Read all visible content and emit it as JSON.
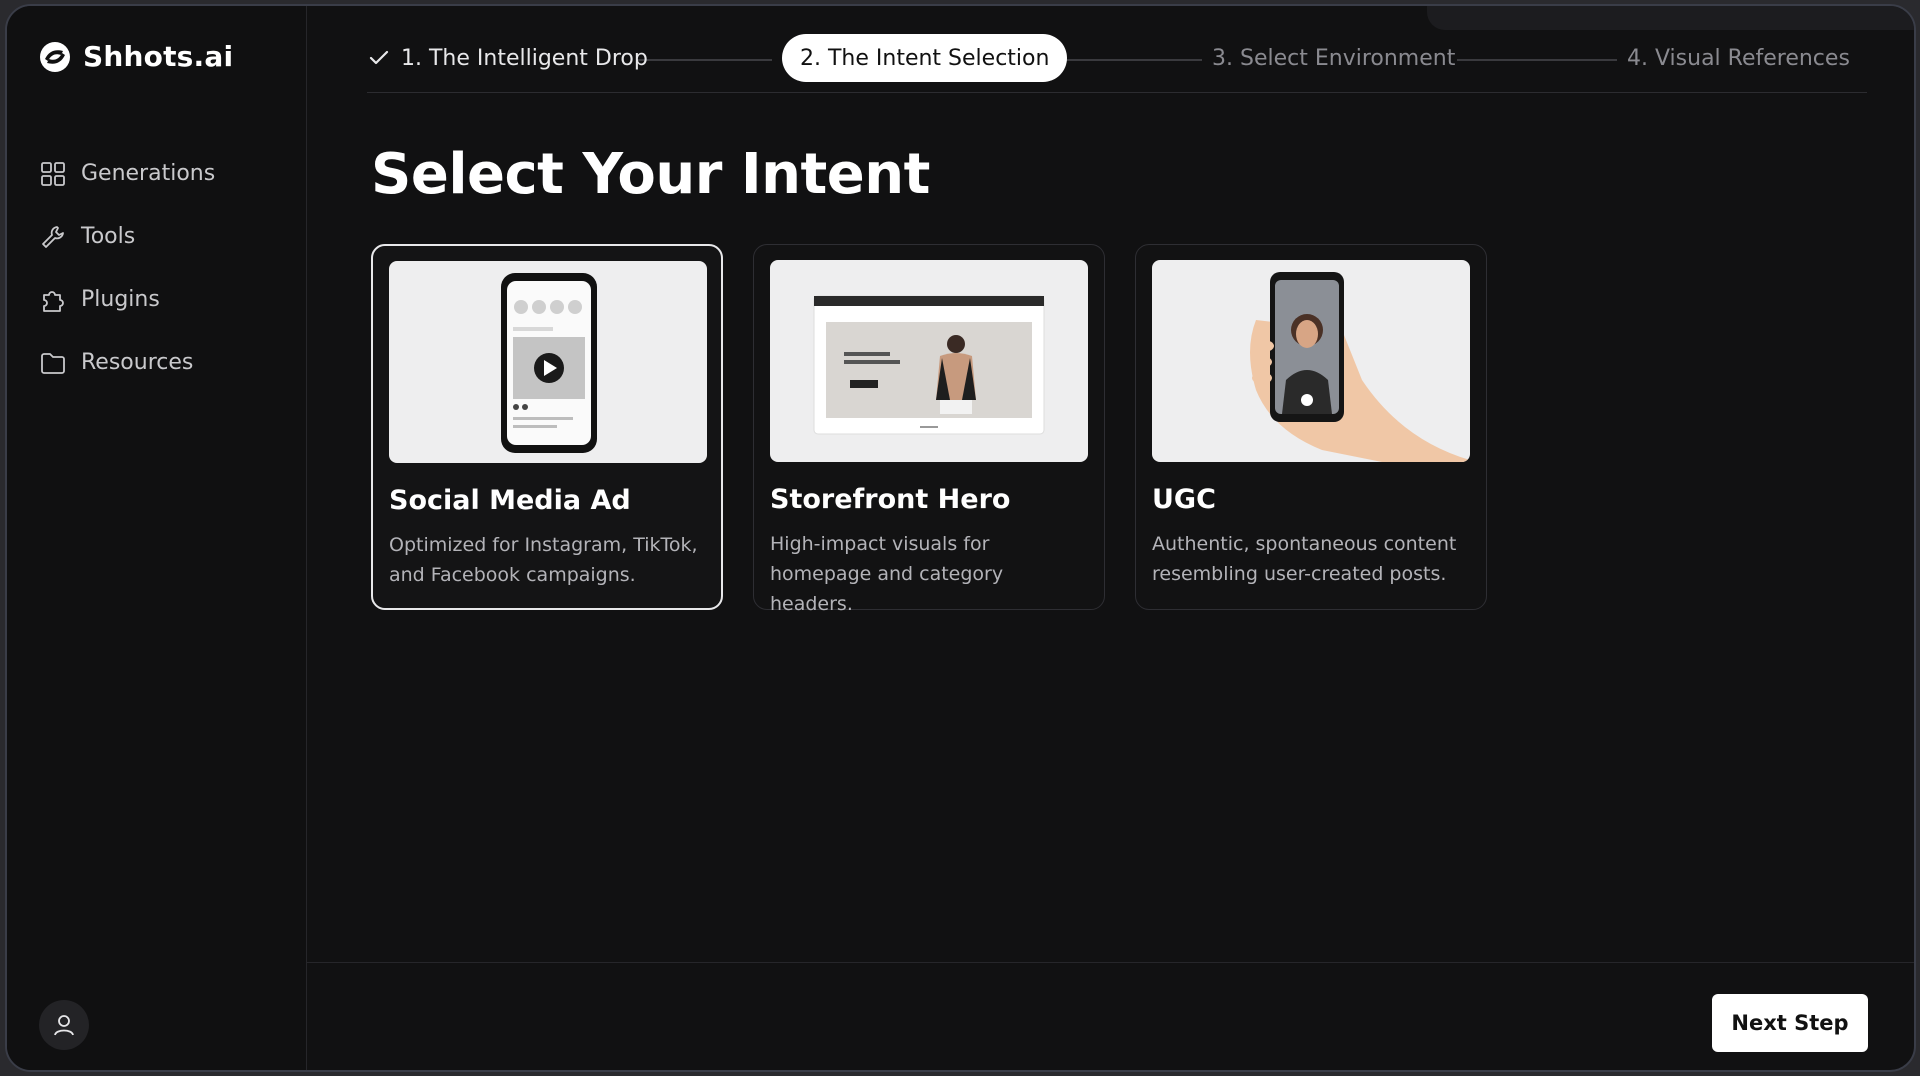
{
  "brand": {
    "name": "Shhots.ai"
  },
  "sidebar": {
    "items": [
      {
        "label": "Generations",
        "icon": "grid-icon"
      },
      {
        "label": "Tools",
        "icon": "wrench-icon"
      },
      {
        "label": "Plugins",
        "icon": "puzzle-icon"
      },
      {
        "label": "Resources",
        "icon": "folder-icon"
      }
    ],
    "user_icon": "user-icon"
  },
  "stepper": {
    "steps": [
      {
        "label": "1. The Intelligent Drop",
        "state": "completed"
      },
      {
        "label": "2. The Intent Selection",
        "state": "active"
      },
      {
        "label": "3. Select Environment",
        "state": "upcoming"
      },
      {
        "label": "4. Visual References",
        "state": "upcoming"
      }
    ]
  },
  "main": {
    "title": "Select Your Intent",
    "cards": [
      {
        "title": "Social Media Ad",
        "description": "Optimized for Instagram, TikTok, and Facebook campaigns.",
        "selected": true
      },
      {
        "title": "Storefront Hero",
        "description": "High-impact visuals for homepage and category headers.",
        "selected": false
      },
      {
        "title": "UGC",
        "description": "Authentic, spontaneous content resembling user-created posts.",
        "selected": false
      }
    ]
  },
  "footer": {
    "next_label": "Next Step"
  },
  "colors": {
    "background": "#111112",
    "accent": "#ffffff",
    "muted_text": "#8a8a90"
  }
}
